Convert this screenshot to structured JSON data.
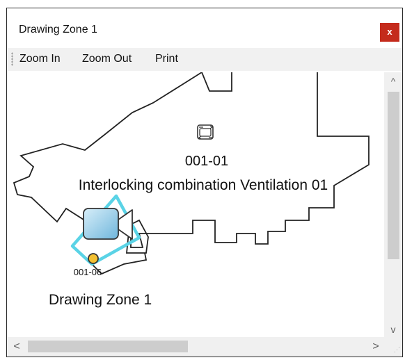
{
  "window": {
    "title": "Drawing Zone 1",
    "close_label": "x"
  },
  "toolbar": {
    "zoom_in": "Zoom In",
    "zoom_out": "Zoom Out",
    "print": "Print"
  },
  "canvas": {
    "device_id": "001-01",
    "device_name": "Interlocking combination Ventilation 01",
    "sensor_id": "001-06",
    "zone_label": "Drawing Zone 1"
  },
  "icons": {
    "ventilation": "ventilation-icon",
    "camera": "camera-icon",
    "sensor": "sensor-dot-icon"
  },
  "colors": {
    "close_button": "#c42b1c",
    "camera_fov": "#5ad3e6",
    "sensor_dot": "#f2c032",
    "zone_outline": "#222222"
  },
  "scrollbars": {
    "up": "^",
    "down": "v",
    "left": "<",
    "right": ">"
  }
}
